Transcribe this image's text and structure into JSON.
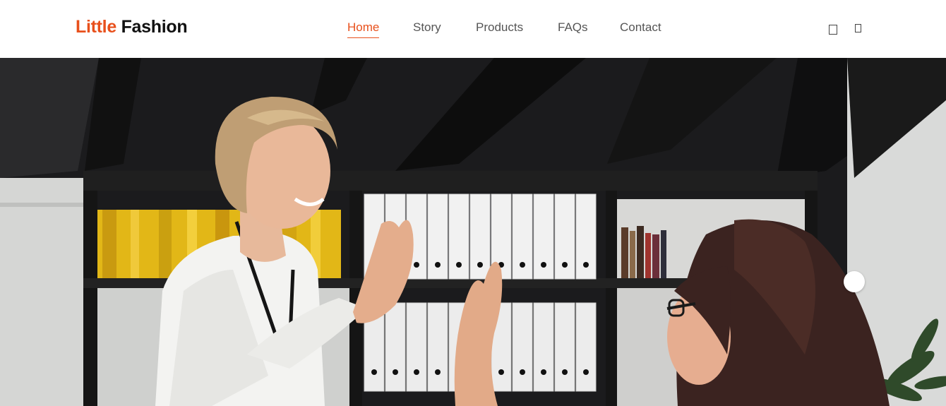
{
  "brand": {
    "accent": "Little",
    "name": "Fashion"
  },
  "nav": {
    "items": [
      {
        "label": "Home",
        "active": true
      },
      {
        "label": "Story",
        "active": false
      },
      {
        "label": "Products",
        "active": false
      },
      {
        "label": "FAQs",
        "active": false
      },
      {
        "label": "Contact",
        "active": false
      }
    ],
    "icons": [
      "user-icon",
      "bag-icon"
    ]
  },
  "colors": {
    "accent": "#e8501c",
    "text": "#555555",
    "brand_dark": "#111111"
  },
  "hero": {
    "image": "office-high-five-photo",
    "slider_dots": 1
  }
}
